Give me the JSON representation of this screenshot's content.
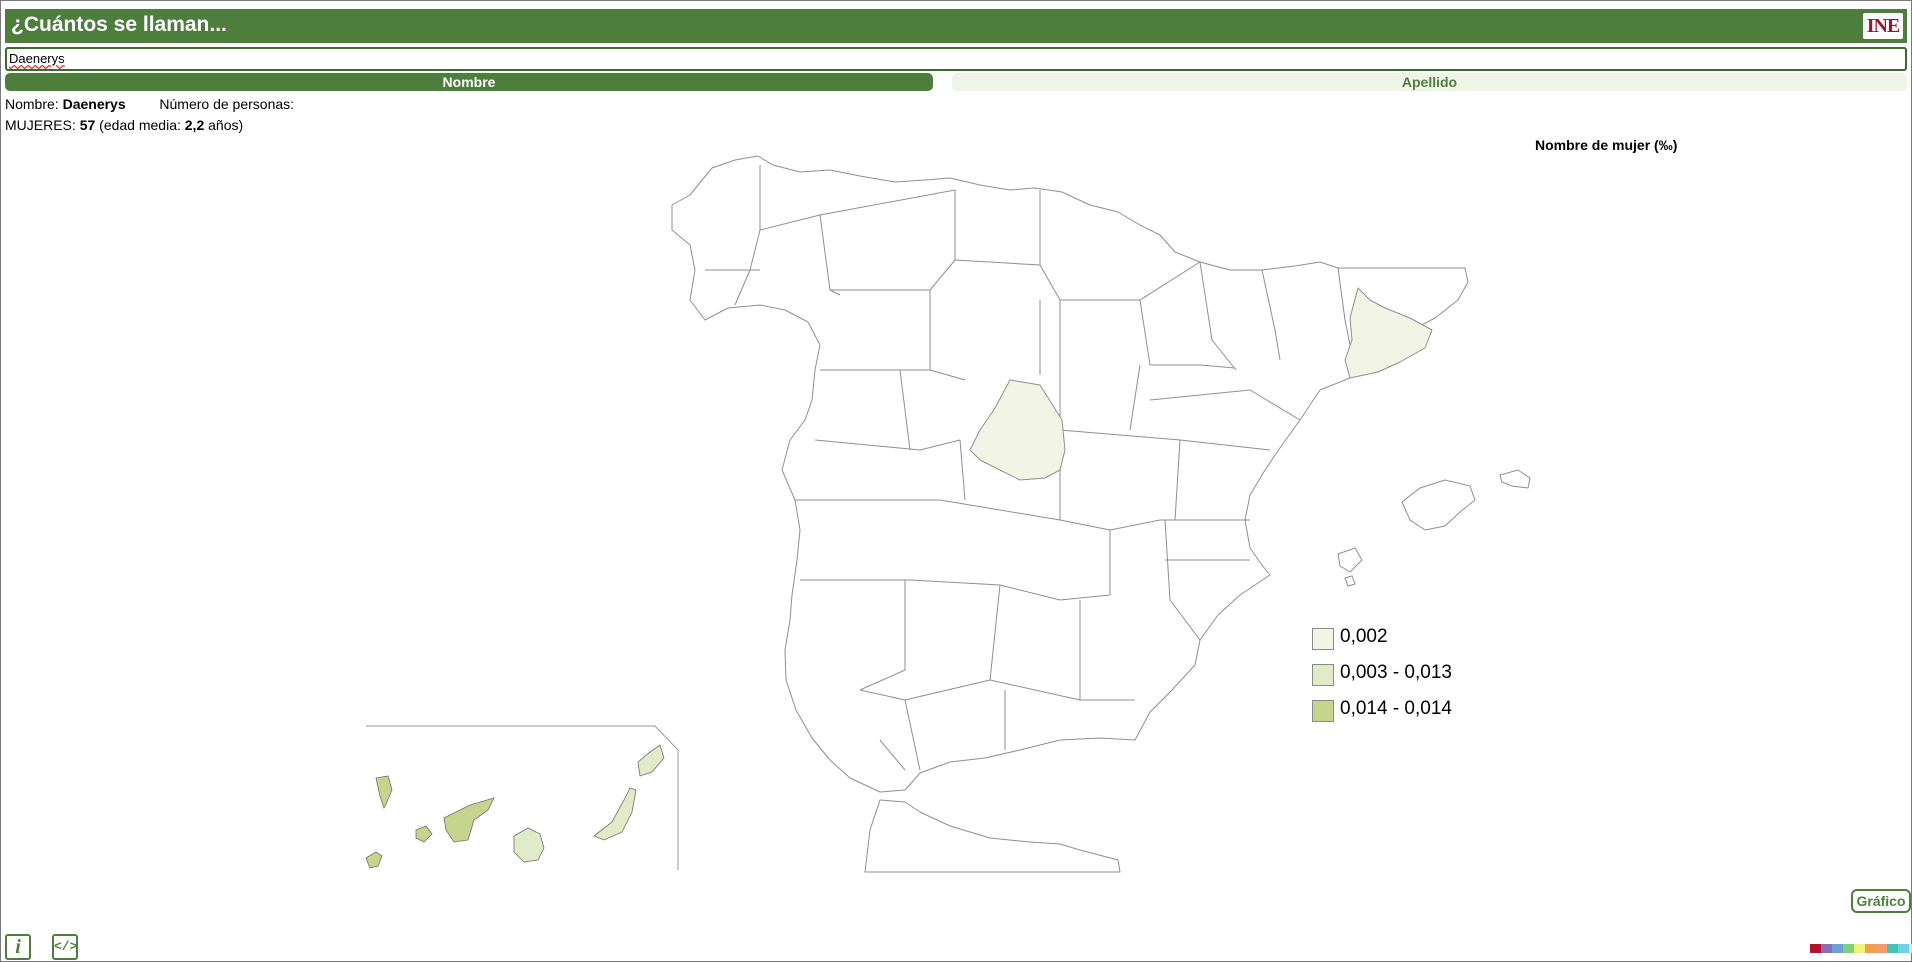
{
  "header": {
    "title": "¿Cuántos se llaman...",
    "logo_text": "INE"
  },
  "search": {
    "value": "Daenerys"
  },
  "tabs": [
    {
      "label": "Nombre",
      "active": true
    },
    {
      "label": "Apellido",
      "active": false
    }
  ],
  "info": {
    "name_label": "Nombre:",
    "name_value": "Daenerys",
    "people_label": "Número de personas:",
    "women_label": "MUJERES:",
    "women_count": "57",
    "age_prefix": "(edad media:",
    "age_value": "2,2",
    "age_suffix": "años)"
  },
  "map": {
    "title": "Nombre de mujer (‰)",
    "colors": {
      "none": "#ffffff",
      "low": "#f2f5e6",
      "mid": "#e2ebc8",
      "high": "#c6d58e",
      "stroke": "#8f8f8f"
    },
    "highlighted_regions": [
      {
        "name": "Madrid",
        "class": "low"
      },
      {
        "name": "Barcelona",
        "class": "low"
      },
      {
        "name": "La Palma",
        "class": "high"
      },
      {
        "name": "El Hierro",
        "class": "high"
      },
      {
        "name": "La Gomera",
        "class": "high"
      },
      {
        "name": "Tenerife",
        "class": "high"
      },
      {
        "name": "Gran Canaria",
        "class": "mid"
      },
      {
        "name": "Fuerteventura",
        "class": "mid"
      },
      {
        "name": "Lanzarote",
        "class": "mid"
      }
    ]
  },
  "legend": [
    {
      "label": "0,002",
      "color": "#f2f5e6"
    },
    {
      "label": "0,003 - 0,013",
      "color": "#e2ebc8"
    },
    {
      "label": "0,014 - 0,014",
      "color": "#c6d58e"
    }
  ],
  "buttons": {
    "grafico_label": "Gráfico",
    "info_icon": "info-icon",
    "code_icon": "code-icon"
  },
  "palette": [
    "#b3122e",
    "#8a6fb0",
    "#6aa0d6",
    "#7cd07c",
    "#f2f27a",
    "#f0a050",
    "#f39c6b",
    "#49c0b6",
    "#6fd0e8",
    "#cfe0f8"
  ]
}
